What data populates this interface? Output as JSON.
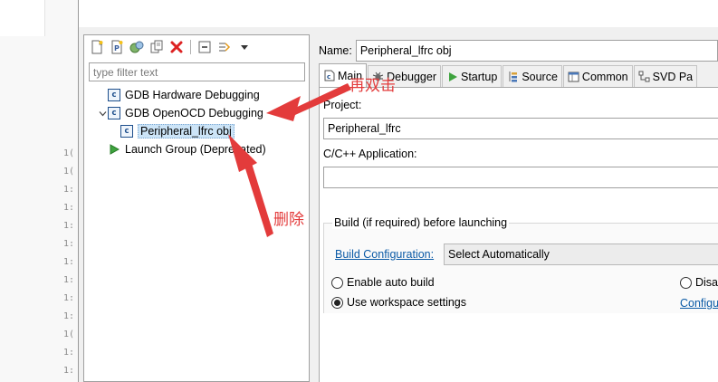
{
  "editor": {
    "line_numbers": [
      "1(",
      "1(",
      "1:",
      "1:",
      "1:",
      "1:",
      "1:",
      "1:",
      "1:",
      "1:",
      "1(",
      "1:",
      "1:"
    ]
  },
  "tree": {
    "filter_placeholder": "type filter text",
    "items": [
      {
        "label": "GDB Hardware Debugging",
        "icon": "c-config-icon"
      },
      {
        "label": "GDB OpenOCD Debugging",
        "icon": "c-config-icon",
        "expanded": true
      },
      {
        "label": "Peripheral_lfrc obj",
        "icon": "c-config-icon",
        "selected": true
      },
      {
        "label": "Launch Group (Deprecated)",
        "icon": "launch-group-icon"
      }
    ]
  },
  "form": {
    "name_label": "Name:",
    "name_value": "Peripheral_lfrc obj",
    "tabs": [
      {
        "label": "Main",
        "icon": "main-tab-icon",
        "active": true
      },
      {
        "label": "Debugger",
        "icon": "debugger-tab-icon"
      },
      {
        "label": "Startup",
        "icon": "startup-tab-icon"
      },
      {
        "label": "Source",
        "icon": "source-tab-icon"
      },
      {
        "label": "Common",
        "icon": "common-tab-icon"
      },
      {
        "label": "SVD Pa",
        "icon": "svd-tab-icon"
      }
    ],
    "project_label": "Project:",
    "project_value": "Peripheral_lfrc",
    "app_label": "C/C++ Application:",
    "app_value": "",
    "build_group_title": "Build (if required) before launching",
    "build_config_link": "Build Configuration:",
    "build_config_value": "Select Automatically",
    "enable_auto_build": "Enable auto build",
    "disable_auto_build": "Disa",
    "use_workspace_settings": "Use workspace settings",
    "configure_link": "Configu"
  },
  "annotations": {
    "top": "再双击",
    "bottom": "删除",
    "color": "#e33b3b"
  }
}
